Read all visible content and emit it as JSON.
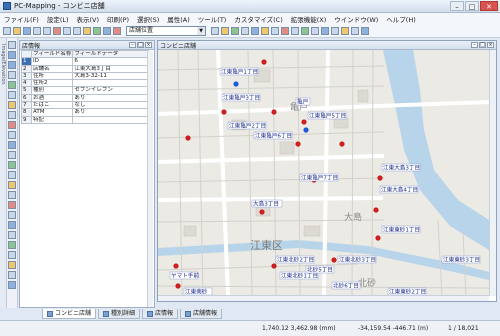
{
  "window": {
    "title": "PC-Mapping - コンビニ店舗"
  },
  "menu": [
    "ファイル(F)",
    "設定(L)",
    "表示(V)",
    "印刷(P)",
    "選択(S)",
    "属性(A)",
    "ツール(T)",
    "カスタマイズ(C)",
    "拡張機能(X)",
    "ウインドウ(W)",
    "ヘルプ(H)"
  ],
  "toolbar": {
    "layer_select": "店舗位置"
  },
  "sidestrip": {
    "label": "Image/Elevation"
  },
  "info_panel": {
    "title": "店情報",
    "headers": [
      "フィールド名称",
      "フィールドデータ"
    ],
    "rows": [
      {
        "num": "1",
        "name": "ID",
        "value": "6"
      },
      {
        "num": "2",
        "name": "店舗名",
        "value": "江東大島3丁目"
      },
      {
        "num": "3",
        "name": "住所",
        "value": "大島3-32-11"
      },
      {
        "num": "4",
        "name": "住所2",
        "value": ""
      },
      {
        "num": "5",
        "name": "種別",
        "value": "セブンイレブン"
      },
      {
        "num": "6",
        "name": "お酒",
        "value": "あり"
      },
      {
        "num": "7",
        "name": "たばこ",
        "value": "なし"
      },
      {
        "num": "8",
        "name": "ATM",
        "value": "あり"
      },
      {
        "num": "9",
        "name": "特記",
        "value": ""
      }
    ]
  },
  "map_window": {
    "title": "コンビニ店舗",
    "labels": [
      {
        "text": "江東亀戸1丁目"
      },
      {
        "text": "江東亀戸3丁目"
      },
      {
        "text": "江東亀戸2丁目"
      },
      {
        "text": "亀戸"
      },
      {
        "text": "江東亀戸5丁目"
      },
      {
        "text": "江東亀戸6丁目"
      },
      {
        "text": "江東亀戸7丁目"
      },
      {
        "text": "江東大島3丁目"
      },
      {
        "text": "江東大島4丁目"
      },
      {
        "text": "大島3丁目"
      },
      {
        "text": "江東東砂1丁目"
      },
      {
        "text": "江東北砂2丁目"
      },
      {
        "text": "江東北砂3丁目"
      },
      {
        "text": "江東北砂1丁目"
      },
      {
        "text": "北砂5丁目"
      },
      {
        "text": "ヤマト手前"
      },
      {
        "text": "北砂6丁目"
      },
      {
        "text": "江東東砂3丁目"
      },
      {
        "text": "江東南砂"
      },
      {
        "text": "江東東砂2丁目"
      }
    ],
    "place_labels": [
      "江東区",
      "亀戸",
      "大島",
      "北砂"
    ]
  },
  "tabs": [
    "コンビニ店舗",
    "種別詳細",
    "店情報",
    "店舗情報"
  ],
  "status": {
    "coords1": "1,740.12 3,462.98 (mm)",
    "coords2": "-34,159.54 -446.71 (m)",
    "count": "1 / 18,021"
  },
  "colors": {
    "marker_red": "#cc1f1f",
    "marker_blue": "#1a5bd6",
    "label_text": "#1a2a88",
    "map_bg": "#ebeae4",
    "river": "#b8d4ea"
  }
}
